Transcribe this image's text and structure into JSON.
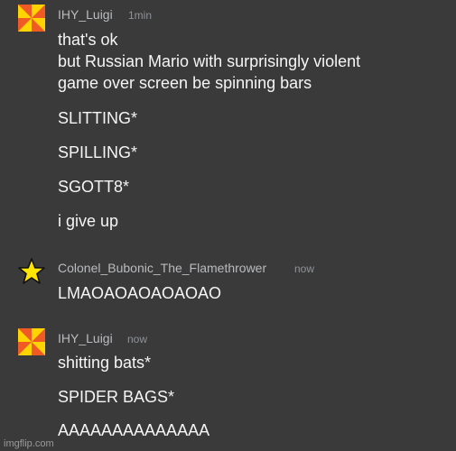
{
  "messages": [
    {
      "username": "IHY_Luigi",
      "time": "1min",
      "avatar_icon": "pinwheel-icon",
      "lines": [
        "that's ok",
        "but Russian Mario with surprisingly violent",
        "game over screen be spinning bars",
        "SLITTING*",
        "SPILLING*",
        "SGOTT8*",
        "i give up"
      ]
    },
    {
      "username": "Colonel_Bubonic_The_Flamethrower",
      "time": "now",
      "avatar_icon": "star-icon",
      "lines": [
        "LMAOAOAOAOAOAO"
      ]
    },
    {
      "username": "IHY_Luigi",
      "time": "now",
      "avatar_icon": "pinwheel-icon",
      "lines": [
        "shitting bats*",
        "SPIDER BAGS*",
        "AAAAAAAAAAAAAA"
      ]
    }
  ],
  "watermark": "imgflip.com",
  "colors": {
    "background": "#3a3a3b",
    "username": "#b9bbbe",
    "timestamp": "#8e9297",
    "text": "#f5f5f5",
    "pinwheel_orange": "#f05a24",
    "pinwheel_yellow": "#ffd400",
    "star_fill": "#ffe600"
  }
}
